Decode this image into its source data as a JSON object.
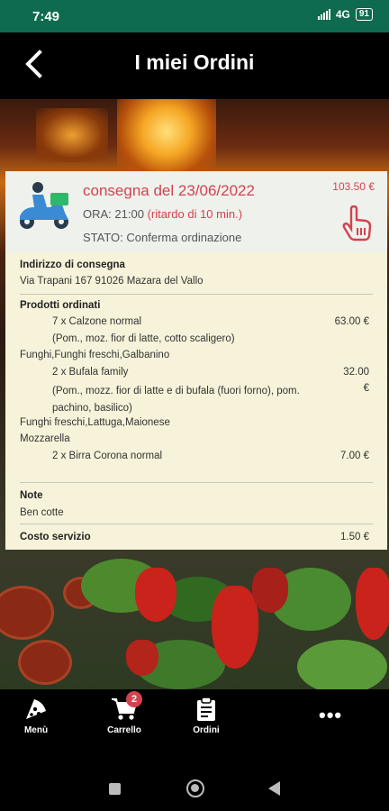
{
  "status_bar": {
    "time": "7:49",
    "network": "4G",
    "battery": "91"
  },
  "header": {
    "title": "I miei Ordini"
  },
  "order": {
    "date": "consegna del 23/06/2022",
    "total": "103.50 €",
    "time_prefix": "ORA: 21:00",
    "delay": "(ritardo di 10 min.)",
    "status": "STATO: Conferma ordinazione",
    "address_label": "Indirizzo di consegna",
    "address": "Via Trapani 167 91026 Mazara del Vallo",
    "products_label": "Prodotti ordinati",
    "items": [
      {
        "line1": "7 x Calzone normal",
        "desc": "(Pom., moz. fior di latte, cotto scaligero)",
        "extras": "Funghi,Funghi freschi,Galbanino",
        "price": "63.00 €"
      },
      {
        "line1": "2 x Bufala family",
        "desc": "(Pom., mozz. fior di latte e di bufala (fuori forno), pom. pachino, basilico)",
        "extras": "Funghi freschi,Lattuga,Maionese",
        "extras2": "Mozzarella",
        "price": "32.00",
        "price_unit": "€"
      },
      {
        "line1": "2 x Birra Corona normal",
        "price": "7.00 €"
      }
    ],
    "notes_label": "Note",
    "notes": "Ben cotte",
    "service_label": "Costo servizio",
    "service_price": "1.50 €"
  },
  "bottom_nav": {
    "menu": "Menù",
    "cart": "Carrello",
    "cart_badge": "2",
    "orders": "Ordini",
    "more": "•••"
  },
  "colors": {
    "accent": "#d4424f",
    "statusbar": "#0e6b4f",
    "card": "#f6f3da"
  }
}
